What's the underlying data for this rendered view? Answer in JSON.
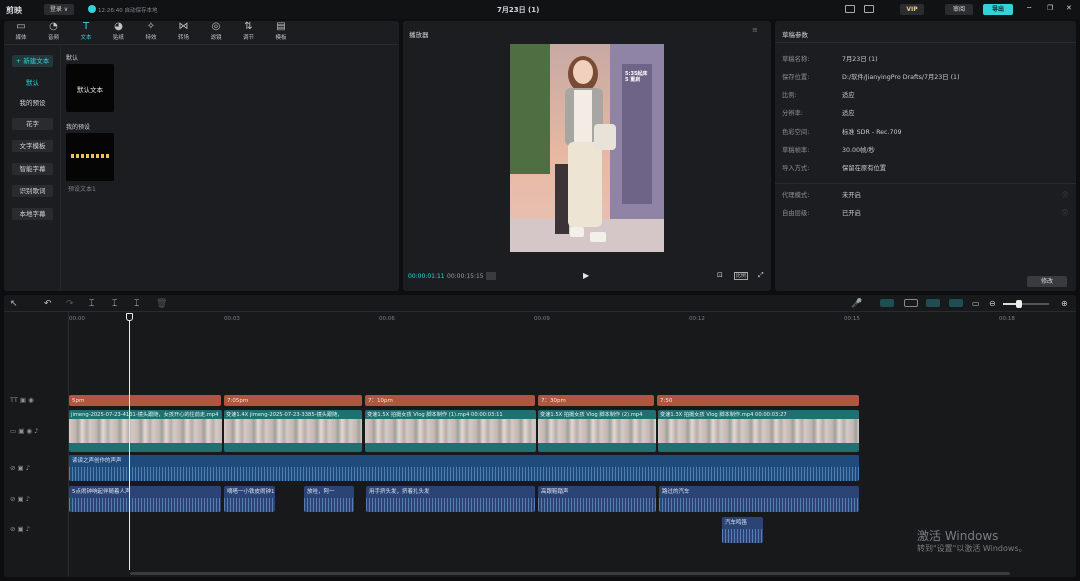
{
  "app": {
    "logo": "剪映",
    "user_label": "登录 ∨",
    "autosave": "12:26:40 自动保存本地",
    "project_title": "7月23日 (1)",
    "vip_label": "VIP",
    "review_label": "审阅",
    "export_label": "导出",
    "accent_color": "#35d2d9"
  },
  "toolbar": {
    "tabs": [
      {
        "label": "媒体",
        "icon": "media-icon"
      },
      {
        "label": "音频",
        "icon": "audio-icon"
      },
      {
        "label": "文本",
        "icon": "text-icon"
      },
      {
        "label": "贴纸",
        "icon": "sticker-icon"
      },
      {
        "label": "特效",
        "icon": "effects-icon"
      },
      {
        "label": "转场",
        "icon": "transition-icon"
      },
      {
        "label": "滤镜",
        "icon": "filter-icon"
      },
      {
        "label": "调节",
        "icon": "adjust-icon"
      },
      {
        "label": "模板",
        "icon": "template-icon"
      }
    ]
  },
  "sidebar": {
    "items": [
      "+ 新建文本",
      "默认",
      "我的预设",
      "花字",
      "文字模板",
      "智能字幕",
      "识别歌词",
      "本地字幕"
    ]
  },
  "library": {
    "default_section": "默认",
    "default_card": "默认文本",
    "preset_section": "我的预设",
    "preset_card_label": "预设文本1"
  },
  "player": {
    "title": "播放器",
    "current_time": "00:00:01:11",
    "total_time": "00:00:15:15",
    "ratio_label": "比例",
    "overlay_text": "5:35起床\n5 重启"
  },
  "draft": {
    "title": "草稿参数",
    "props": [
      {
        "label": "草稿名称:",
        "value": "7月23日 (1)"
      },
      {
        "label": "保存位置:",
        "value": "D:/软件/JianyingPro Drafts/7月23日 (1)"
      },
      {
        "label": "比例:",
        "value": "适应"
      },
      {
        "label": "分辨率:",
        "value": "适应"
      },
      {
        "label": "色彩空间:",
        "value": "标准 SDR - Rec.709"
      },
      {
        "label": "草稿帧率:",
        "value": "30.00帧/秒"
      },
      {
        "label": "导入方式:",
        "value": "保留在原有位置"
      },
      {
        "label": "代理模式:",
        "value": "未开启"
      },
      {
        "label": "自由层级:",
        "value": "已开启"
      }
    ],
    "modify_label": "修改"
  },
  "timeline": {
    "ruler": [
      "00:00",
      "00:03",
      "00:06",
      "00:09",
      "00:12",
      "00:15",
      "00:18"
    ],
    "text_clips": [
      "5pm",
      "7:05pm",
      "7：10pm",
      "7：30pm",
      "7:50"
    ],
    "video_clips": [
      "jimeng-2025-07-23-4131-镜头跟随，女孩开心的往前走.mp4",
      "变速1.4X  jimeng-2025-07-23-3385-镜头跟随，",
      "变速1.5X  拍摄女孩 Vlog 脚本制作 (1).mp4  00:00:03:11",
      "变速1.5X  拍摄女孩 Vlog 脚本制作 (2).mp4",
      "变速1.3X  拍摄女孩 Vlog 脚本制作.mp4  00:00:03:27"
    ],
    "voice_clip": "读读之声创作的声声",
    "audio_clips": [
      "5点闹钟响起伴随着人声",
      "嘀嗒一小铁皮闹钟1",
      "放哇，阿一",
      "用手挤头发，挤着扎头发",
      "高跟鞋踏声",
      "路过的汽车"
    ],
    "extra_clip": "汽车鸣笛"
  },
  "watermark": {
    "line1": "激活 Windows",
    "line2": "转到\"设置\"以激活 Windows。"
  }
}
